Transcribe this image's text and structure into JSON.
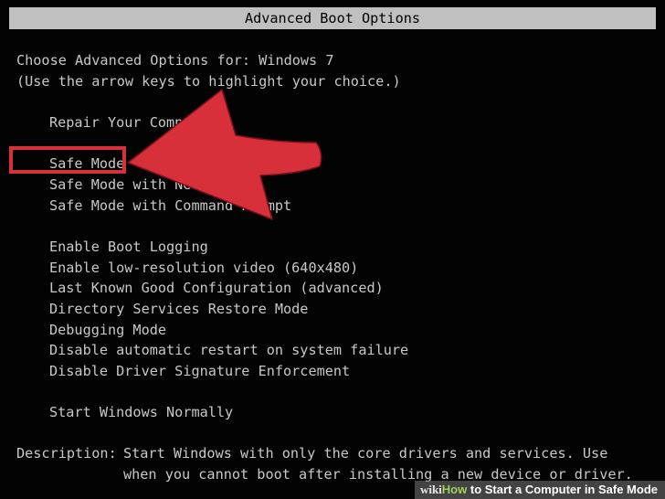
{
  "title": "Advanced Boot Options",
  "header": {
    "line1": "Choose Advanced Options for: Windows 7",
    "line2": "(Use the arrow keys to highlight your choice.)"
  },
  "menu": {
    "repair": "Repair Your Computer",
    "safe_mode": "Safe Mode",
    "safe_mode_networking": "Safe Mode with Networking",
    "safe_mode_command_prompt": "Safe Mode with Command Prompt",
    "enable_boot_logging": "Enable Boot Logging",
    "low_res_video": "Enable low-resolution video (640x480)",
    "last_known_good": "Last Known Good Configuration (advanced)",
    "directory_services": "Directory Services Restore Mode",
    "debugging": "Debugging Mode",
    "disable_auto_restart": "Disable automatic restart on system failure",
    "disable_driver_sig": "Disable Driver Signature Enforcement",
    "start_normally": "Start Windows Normally"
  },
  "description": {
    "label": "Description:",
    "line1": "Start Windows with only the core drivers and services. Use",
    "line2": "when you cannot boot after installing a new device or driver."
  },
  "watermark": {
    "wiki": "wiki",
    "how": "How",
    "rest": " to Start a Computer in Safe Mode"
  },
  "colors": {
    "background": "#030303",
    "text": "#c8c8c8",
    "title_bar": "#c0c0c0",
    "highlight_arrow": "#d8303a"
  }
}
